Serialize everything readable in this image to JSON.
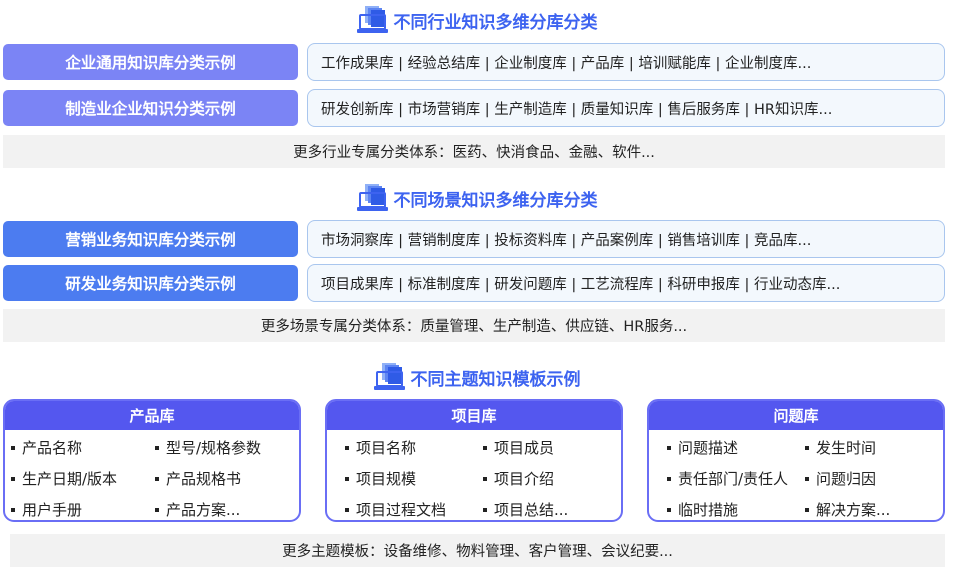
{
  "sections": [
    {
      "title": "不同行业知识多维分库分类",
      "rows": [
        {
          "label": "企业通用知识库分类示例",
          "items": "工作成果库 | 经验总结库 | 企业制度库 | 产品库 | 培训赋能库 | 企业制度库..."
        },
        {
          "label": "制造业企业知识分类示例",
          "items": "研发创新库 | 市场营销库 | 生产制造库 | 质量知识库 | 售后服务库 | HR知识库..."
        }
      ],
      "more": "更多行业专属分类体系：医药、快消食品、金融、软件..."
    },
    {
      "title": "不同场景知识多维分库分类",
      "rows": [
        {
          "label": "营销业务知识库分类示例",
          "items": "市场洞察库 | 营销制度库 | 投标资料库 | 产品案例库 | 销售培训库 | 竞品库..."
        },
        {
          "label": "研发业务知识库分类示例",
          "items": "项目成果库 | 标准制度库 | 研发问题库 | 工艺流程库 | 科研申报库 | 行业动态库..."
        }
      ],
      "more": "更多场景专属分类体系：质量管理、生产制造、供应链、HR服务..."
    },
    {
      "title": "不同主题知识模板示例",
      "cards": [
        {
          "title": "产品库",
          "items": [
            "产品名称",
            "型号/规格参数",
            "生产日期/版本",
            "产品规格书",
            "用户手册",
            "产品方案..."
          ]
        },
        {
          "title": "项目库",
          "items": [
            "项目名称",
            "项目成员",
            "项目规模",
            "项目介绍",
            "项目过程文档",
            "项目总结..."
          ]
        },
        {
          "title": "问题库",
          "items": [
            "问题描述",
            "发生时间",
            "责任部门/责任人",
            "问题归因",
            "临时措施",
            "解决方案..."
          ]
        }
      ],
      "more": "更多主题模板：设备维修、物料管理、客户管理、会议纪要..."
    }
  ],
  "colors": {
    "title_blue": "#3d63f0",
    "label_violet": "#7b84f5",
    "label_blue": "#4c7cf0",
    "card_header": "#5457ef",
    "more_bar_bg": "#f2f2f2"
  },
  "icons": {
    "section_icon": "monitor-documents-icon"
  }
}
